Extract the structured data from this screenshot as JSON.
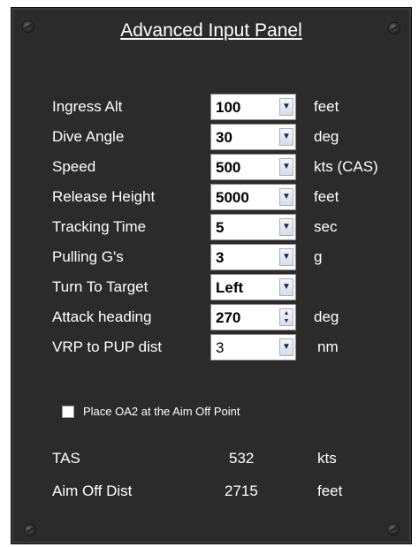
{
  "panel": {
    "title": "Advanced Input Panel"
  },
  "inputs": [
    {
      "label": "Ingress Alt",
      "value": "100",
      "unit": "feet",
      "control": "dropdown"
    },
    {
      "label": "Dive Angle",
      "value": "30",
      "unit": "deg",
      "control": "dropdown"
    },
    {
      "label": "Speed",
      "value": "500",
      "unit": "kts (CAS)",
      "control": "dropdown"
    },
    {
      "label": "Release Height",
      "value": "5000",
      "unit": "feet",
      "control": "dropdown"
    },
    {
      "label": "Tracking Time",
      "value": "5",
      "unit": "sec",
      "control": "dropdown"
    },
    {
      "label": "Pulling G's",
      "value": "3",
      "unit": "g",
      "control": "dropdown"
    },
    {
      "label": "Turn To Target",
      "value": "Left",
      "unit": "",
      "control": "dropdown"
    },
    {
      "label": "Attack heading",
      "value": "270",
      "unit": "deg",
      "control": "spinner"
    },
    {
      "label": "VRP to PUP dist",
      "value": "3",
      "unit": "nm",
      "control": "dropdown"
    }
  ],
  "checkbox": {
    "label": "Place OA2 at the Aim Off Point",
    "checked": false
  },
  "outputs": [
    {
      "label": "TAS",
      "value": "532",
      "unit": "kts"
    },
    {
      "label": "Aim Off Dist",
      "value": "2715",
      "unit": "feet"
    }
  ],
  "icons": {
    "dropdown": "chevron-down-icon",
    "spinner": "spinner-icon",
    "screw": "screw-icon"
  }
}
